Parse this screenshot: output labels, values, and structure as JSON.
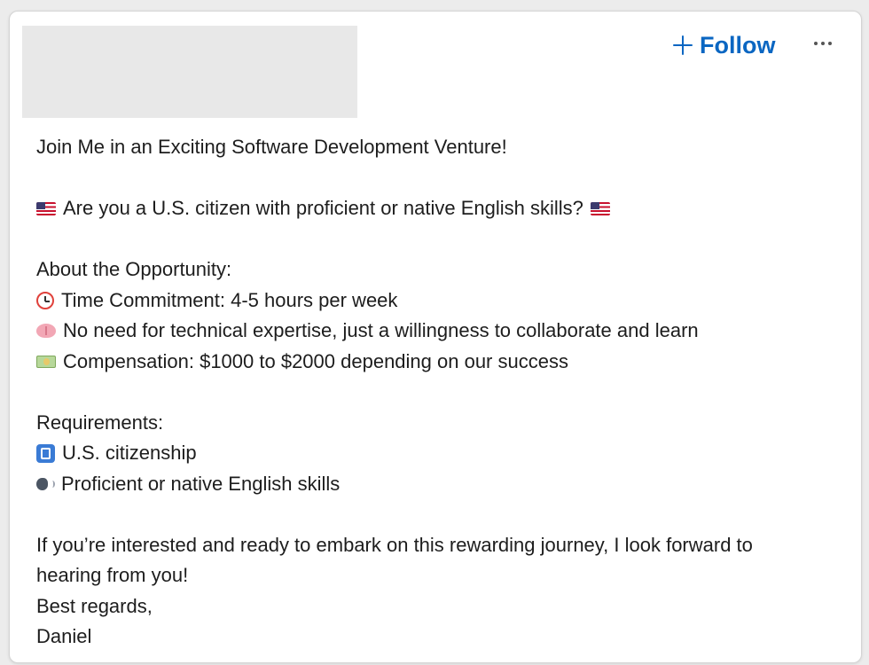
{
  "header": {
    "follow_label": "Follow",
    "accent_color": "#0a66c2"
  },
  "post": {
    "title": "Join Me in an Exciting Software Development Venture!",
    "question": "Are you a U.S. citizen with proficient or native English skills?",
    "about_heading": "About the Opportunity:",
    "about_items": [
      {
        "icon": "alarm-clock-icon",
        "text": "Time Commitment: 4-5 hours per week"
      },
      {
        "icon": "brain-icon",
        "text": "No need for technical expertise, just a willingness to collaborate and learn"
      },
      {
        "icon": "money-icon",
        "text": "Compensation: $1000 to $2000 depending on our success"
      }
    ],
    "requirements_heading": "Requirements:",
    "requirement_items": [
      {
        "icon": "passport-control-icon",
        "text": "U.S. citizenship"
      },
      {
        "icon": "speaking-head-icon",
        "text": "Proficient or native English skills"
      }
    ],
    "closing": "If you’re interested and ready to embark on this rewarding journey, I look forward to hearing from you!",
    "signoff": "Best regards,",
    "signature": "Daniel"
  }
}
